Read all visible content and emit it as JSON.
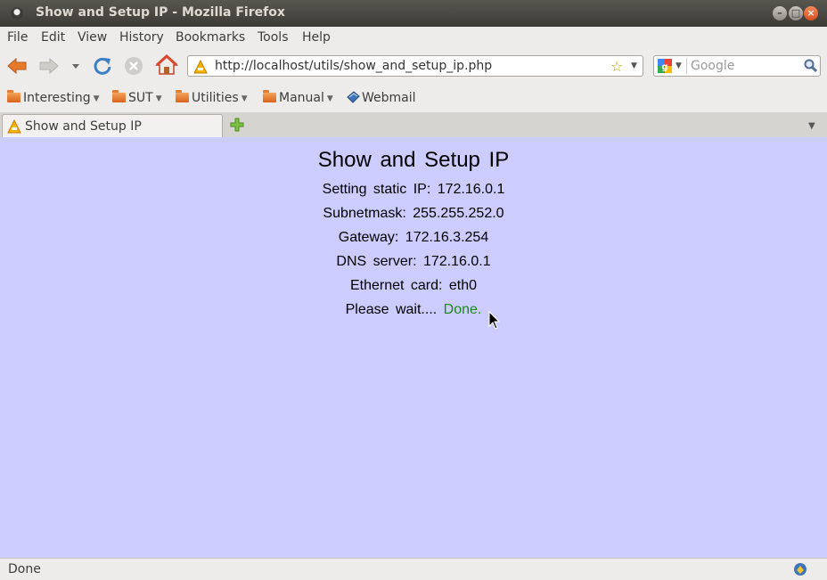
{
  "window": {
    "title": "Show and Setup IP - Mozilla Firefox"
  },
  "menu": [
    "File",
    "Edit",
    "View",
    "History",
    "Bookmarks",
    "Tools",
    "Help"
  ],
  "nav": {
    "url": "http://localhost/utils/show_and_setup_ip.php",
    "search_placeholder": "Google"
  },
  "bookmarks": [
    {
      "label": "Interesting",
      "type": "folder"
    },
    {
      "label": "SUT",
      "type": "folder"
    },
    {
      "label": "Utilities",
      "type": "folder"
    },
    {
      "label": "Manual",
      "type": "folder"
    },
    {
      "label": "Webmail",
      "type": "link"
    }
  ],
  "tabs": [
    {
      "label": "Show and Setup IP",
      "active": true
    }
  ],
  "page": {
    "heading": "Show and Setup IP",
    "lines": [
      "Setting static IP: 172.16.0.1",
      "Subnetmask: 255.255.252.0",
      "Gateway: 172.16.3.254",
      "DNS server: 172.16.0.1",
      "Ethernet card: eth0"
    ],
    "wait_text": "Please wait....",
    "done_text": "Done."
  },
  "status": {
    "text": "Done"
  },
  "colors": {
    "page_bg": "#ccccff",
    "done_green": "#1a8a1a",
    "titlebar": "#3c3b37"
  }
}
